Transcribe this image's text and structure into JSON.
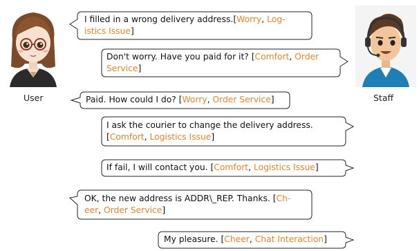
{
  "participants": {
    "user": {
      "label": "User"
    },
    "staff": {
      "label": "Staff"
    }
  },
  "colors": {
    "annotation": "#e8842a",
    "text": "#111111"
  },
  "turns": [
    {
      "speaker": "user",
      "text_lines": [
        "I filled in a wrong delivery address.[",
        "istics Issue]"
      ],
      "emotion": "Worry",
      "topic_parts": [
        "Log-",
        "istics Issue"
      ],
      "topic": "Logistics Issue"
    },
    {
      "speaker": "staff",
      "text": "Don't worry. Have you paid for it? [",
      "emotion": "Comfort",
      "topic": "Order Service"
    },
    {
      "speaker": "user",
      "text": "Paid. How could I do? [",
      "emotion": "Worry",
      "topic": "Order Service"
    },
    {
      "speaker": "staff",
      "text": "I ask the courier to change the delivery address.",
      "emotion": "Comfort",
      "topic": "Logistics Issue"
    },
    {
      "speaker": "staff",
      "text": "If fail, I will contact you. [",
      "emotion": "Comfort",
      "topic": "Logistics Issue"
    },
    {
      "speaker": "user",
      "text": "OK, the new address is ADDR\\_REP. Thanks. [",
      "emotion": "Cheer",
      "emotion_parts": [
        "Ch-",
        "eer"
      ],
      "topic": "Order Service"
    },
    {
      "speaker": "staff",
      "text": "My pleasure. [",
      "emotion": "Cheer",
      "topic": "Chat Interaction"
    }
  ]
}
